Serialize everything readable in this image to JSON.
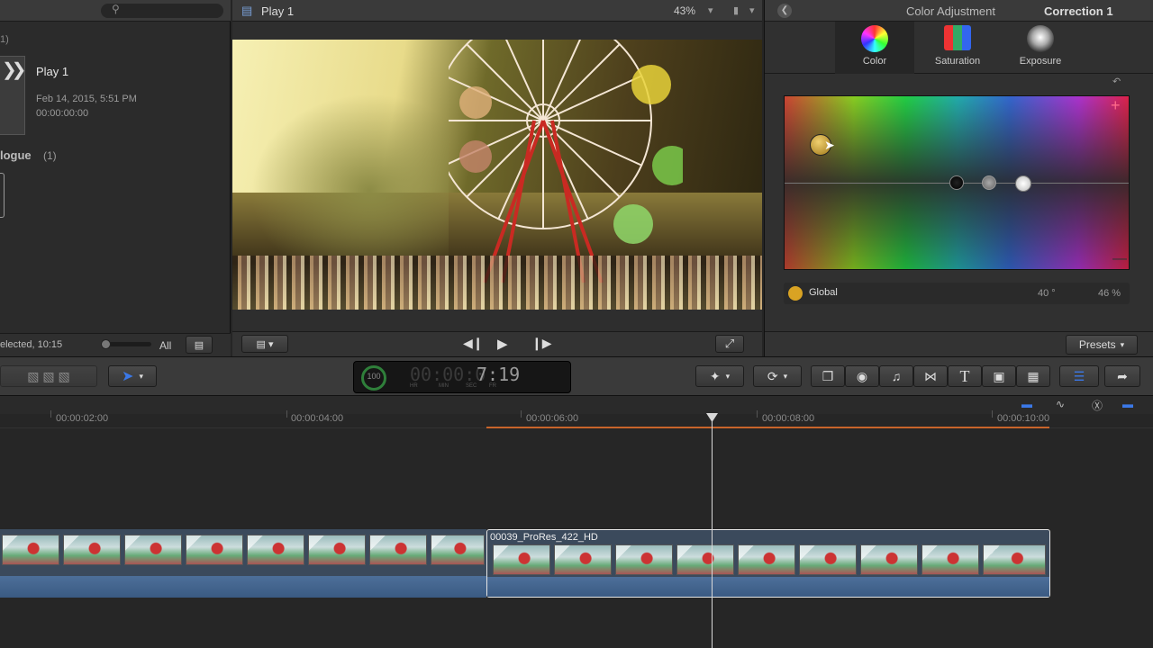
{
  "library": {
    "count_top": "1)",
    "event_title": "Play 1",
    "event_date": "Feb 14, 2015, 5:51 PM",
    "event_timecode": "00:00:00:00",
    "section_label": "logue",
    "section_count": "(1)",
    "status": "elected, 10:15",
    "filter_all": "All"
  },
  "viewer": {
    "title": "Play 1",
    "zoom": "43%"
  },
  "inspector": {
    "header_title": "Color Adjustment",
    "correction": "Correction 1",
    "tabs": [
      {
        "label": "Color"
      },
      {
        "label": "Saturation"
      },
      {
        "label": "Exposure"
      }
    ],
    "global_label": "Global",
    "angle": "40 °",
    "percent": "46 %",
    "presets": "Presets"
  },
  "dashboard": {
    "percent_ring": "100",
    "timecode_dim": "00:00:0",
    "timecode_bright": "7:19",
    "sub_labels": [
      "HR",
      "MIN",
      "SEC",
      "FR"
    ]
  },
  "timeline": {
    "ticks": [
      "00:00:02:00",
      "00:00:04:00",
      "00:00:06:00",
      "00:00:08:00",
      "00:00:10:00"
    ],
    "clip_name": "00039_ProRes_422_HD"
  },
  "colors": {
    "accent": "#3b78e7",
    "playhead": "#d8d8d8",
    "global_swatch": "#d9a323",
    "range_orange": "#c8642a"
  },
  "icons": {
    "transport": [
      "skip-back-icon",
      "play-icon",
      "skip-forward-icon"
    ],
    "toolbar_right": [
      "magic-wand-icon",
      "retime-icon",
      "clip-browser-icon",
      "camera-icon",
      "music-icon",
      "transitions-icon",
      "text-icon",
      "generator-icon",
      "themes-icon",
      "inspector-toggle-icon",
      "share-icon"
    ]
  }
}
